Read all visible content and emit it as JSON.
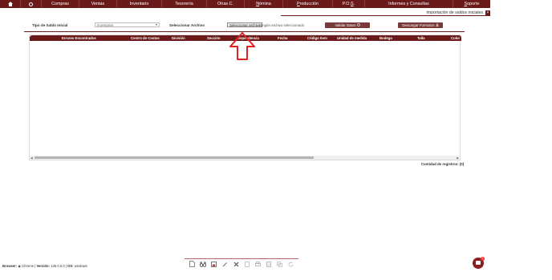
{
  "nav": {
    "items": [
      {
        "label": "Compras"
      },
      {
        "label": "Ventas"
      },
      {
        "label": "Inventario"
      },
      {
        "label": "Tesorería"
      },
      {
        "label": "Otras C."
      },
      {
        "label_pre": "",
        "label_u": "N",
        "label_post": "ómina"
      },
      {
        "label_pre": "",
        "label_u": "P",
        "label_post": "roducción"
      },
      {
        "label_pre": "P.O.",
        "label_u": "S",
        "label_post": "."
      },
      {
        "label": "Informes y Consultas"
      },
      {
        "label_pre": "",
        "label_u": "S",
        "label_post": "oporte"
      }
    ]
  },
  "page": {
    "title": "Importación de saldos iniciales",
    "close_glyph": "×"
  },
  "form": {
    "tipo_label": "Tipo de Saldo Inicial",
    "tipo_value": "Inventarios",
    "archivo_label": "Seleccionar Archivo",
    "file_button": "Seleccionar archivo",
    "file_status": "Ningún archivo seleccionado",
    "validate_button": "Validar Datos",
    "download_button": "Descargar Formatos"
  },
  "table": {
    "columns": [
      "Errores Encontrados",
      "Centro de Costos",
      "División",
      "Sección",
      "Dependencia",
      "Fecha",
      "Código Item",
      "Unidad de medida",
      "Bodega",
      "Talla",
      "Color"
    ],
    "rows": []
  },
  "records_text": "Cantidad de registros: (0)",
  "status": {
    "browser_label": "Browser:",
    "browser_value": "Chrome",
    "version_label": "Versión:",
    "version_value": "136.0.0.0",
    "os_label": "OS:",
    "os_value": "windows"
  },
  "chat": {
    "badge": "1"
  },
  "colors": {
    "brand": "#6b1a1a",
    "accent_button": "#7a3a3a",
    "annotation_arrow": "#e02020"
  }
}
